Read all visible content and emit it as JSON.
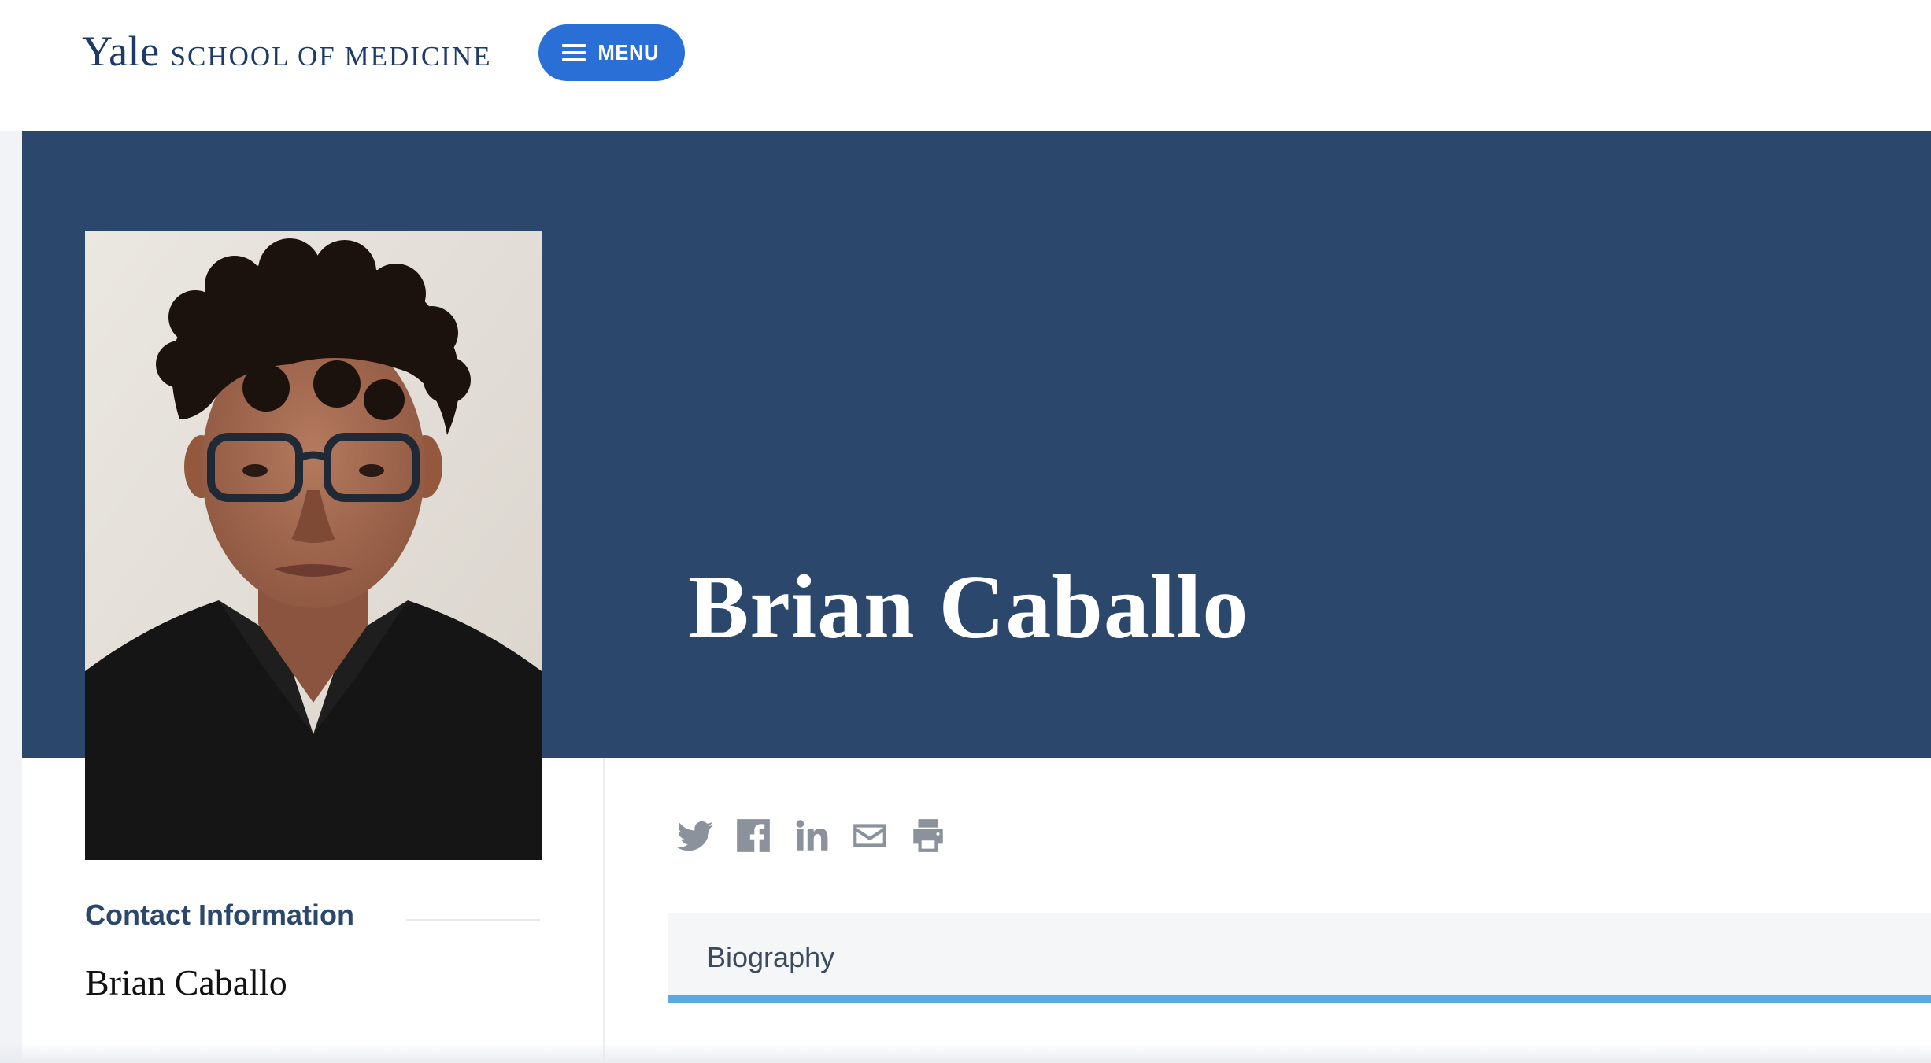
{
  "header": {
    "logo_yale": "Yale",
    "logo_school": "SCHOOL OF MEDICINE",
    "menu_label": "MENU"
  },
  "hero": {
    "name": "Brian Caballo",
    "photo_alt": "Brian Caballo",
    "background_color": "#2b476c"
  },
  "share": {
    "icons": [
      "twitter-icon",
      "facebook-icon",
      "linkedin-icon",
      "email-icon",
      "print-icon"
    ]
  },
  "contact": {
    "heading": "Contact Information",
    "name": "Brian Caballo"
  },
  "tabs": [
    {
      "label": "Biography",
      "active": true
    }
  ],
  "colors": {
    "brand_navy": "#2b476c",
    "menu_blue": "#2a6fd6",
    "tab_accent": "#5aa9e0"
  }
}
